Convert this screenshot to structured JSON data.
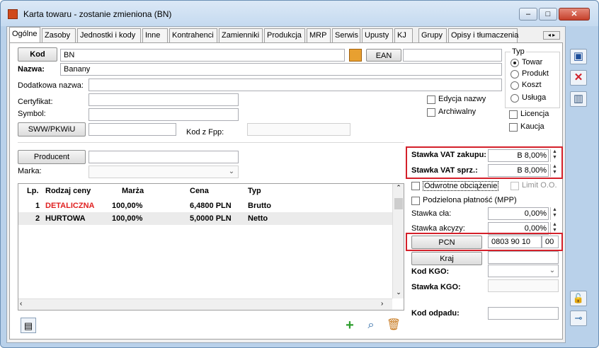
{
  "window": {
    "title": "Karta towaru - zostanie zmieniona (BN)",
    "buttons": {
      "minimize": "–",
      "maximize": "□",
      "close": "✕"
    }
  },
  "tabs": [
    {
      "label": "Ogólne"
    },
    {
      "label": "Zasoby"
    },
    {
      "label": "Jednostki i kody"
    },
    {
      "label": "Inne"
    },
    {
      "label": "Kontrahenci"
    },
    {
      "label": "Zamienniki"
    },
    {
      "label": "Produkcja"
    },
    {
      "label": "MRP"
    },
    {
      "label": "Serwis"
    },
    {
      "label": "Upusty"
    },
    {
      "label": "KJ"
    },
    {
      "label": "Grupy"
    },
    {
      "label": "Opisy i tłumaczenia"
    }
  ],
  "form": {
    "kod_button": "Kod",
    "kod_value": "BN",
    "ean_button": "EAN",
    "ean_value": "",
    "nazwa_label": "Nazwa:",
    "nazwa_value": "Banany",
    "dodatkowa_label": "Dodatkowa nazwa:",
    "certyfikat_label": "Certyfikat:",
    "symbol_label": "Symbol:",
    "sww_button": "SWW/PKWiU",
    "kod_fpp_label": "Kod z Fpp:",
    "edycja_nazwy": "Edycja nazwy",
    "archiwalny": "Archiwalny",
    "typ_label": "Typ",
    "typ_options": [
      "Towar",
      "Produkt",
      "Koszt",
      "Usługa"
    ],
    "typ_selected": "Towar",
    "licencja": "Licencja",
    "kaucja": "Kaucja",
    "producent_button": "Producent",
    "marka_label": "Marka:"
  },
  "prices": {
    "headers": {
      "lp": "Lp.",
      "rodzaj": "Rodzaj ceny",
      "marza": "Marża",
      "cena": "Cena",
      "typ": "Typ"
    },
    "rows": [
      {
        "lp": "1",
        "rodzaj": "DETALICZNA",
        "marza": "100,00%",
        "cena": "6,4800 PLN",
        "typ": "Brutto"
      },
      {
        "lp": "2",
        "rodzaj": "HURTOWA",
        "marza": "100,00%",
        "cena": "5,0000 PLN",
        "typ": "Netto"
      }
    ]
  },
  "vat": {
    "zakupu_label": "Stawka VAT zakupu:",
    "zakupu_value": "B 8,00%",
    "sprz_label": "Stawka VAT sprz.:",
    "sprz_value": "B 8,00%",
    "odwrotne": "Odwrotne obciążenie",
    "limit": "Limit O.O.",
    "podzielona": "Podzielona płatność (MPP)",
    "clo_label": "Stawka cła:",
    "clo_value": "0,00%",
    "akcyzy_label": "Stawka akcyzy:",
    "akcyzy_value": "0,00%",
    "pcn_button": "PCN",
    "pcn_value": "0803 90 10",
    "pcn_suffix": "00",
    "kraj_button": "Kraj",
    "kgo_label": "Kod KGO:",
    "stawka_kgo_label": "Stawka KGO:",
    "odpadu_label": "Kod odpadu:"
  },
  "colors": {
    "highlight": "#d4202a",
    "detaliczna": "#e02020"
  }
}
